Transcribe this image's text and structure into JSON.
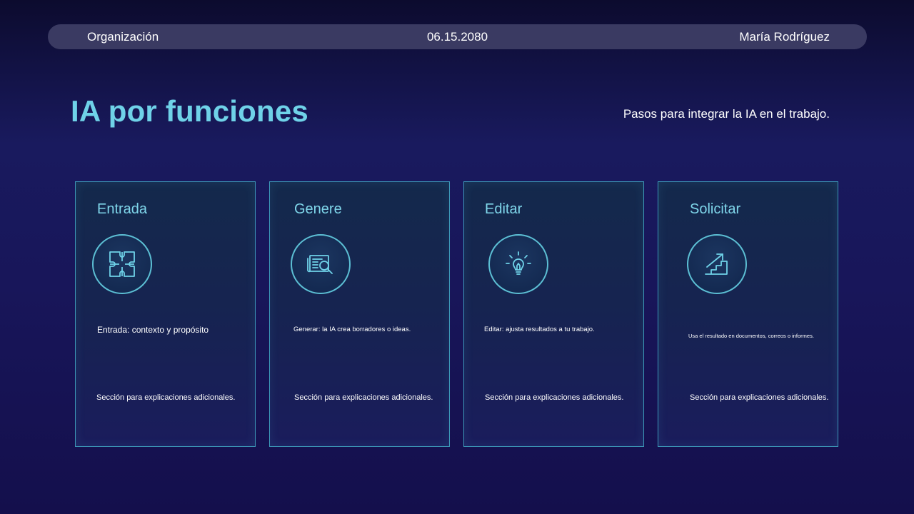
{
  "header": {
    "organization": "Organización",
    "date": "06.15.2080",
    "author": "María Rodríguez"
  },
  "page": {
    "title": "IA por funciones",
    "subtitle": "Pasos para integrar la IA en el trabajo."
  },
  "cards": [
    {
      "title": "Entrada",
      "icon": "puzzle-icon",
      "description": "Entrada: contexto y propósito",
      "extra": "Sección para explicaciones adicionales."
    },
    {
      "title": "Genere",
      "icon": "document-search-icon",
      "description": "Generar: la IA crea borradores o ideas.",
      "extra": "Sección para explicaciones adicionales."
    },
    {
      "title": "Editar",
      "icon": "lightbulb-icon",
      "description": "Editar: ajusta resultados a tu trabajo.",
      "extra": "Sección para explicaciones adicionales."
    },
    {
      "title": "Solicitar",
      "icon": "stairs-arrow-icon",
      "description": "Usa el resultado en documentos, correos o informes.",
      "extra": "Sección para explicaciones adicionales."
    }
  ],
  "colors": {
    "accent": "#6fd2e8",
    "card_border": "#3c96b6",
    "topbar": "#3a3a62",
    "background": "#18165a"
  }
}
